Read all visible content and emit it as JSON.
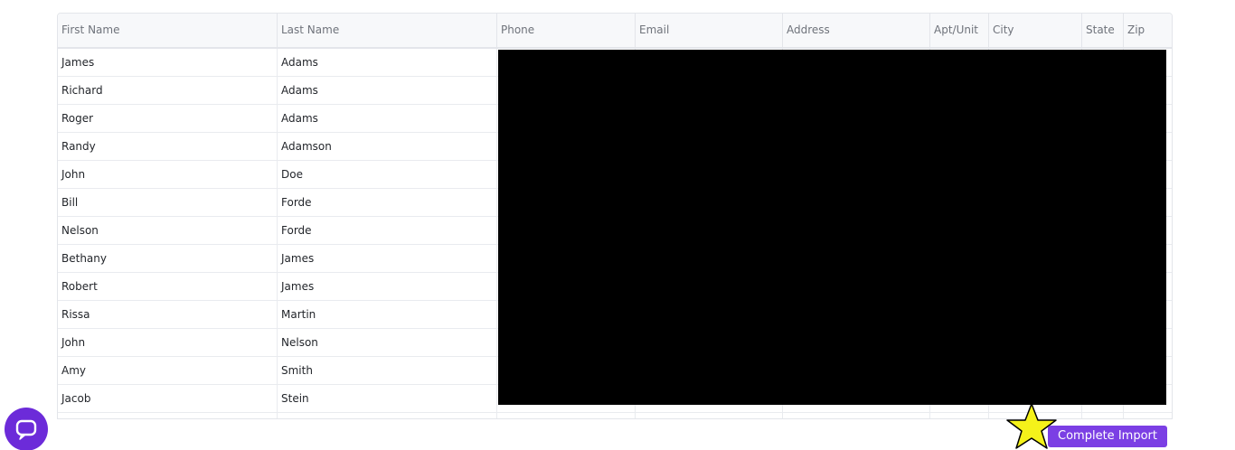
{
  "table": {
    "headers": [
      "First Name",
      "Last Name",
      "Phone",
      "Email",
      "Address",
      "Apt/Unit",
      "City",
      "State",
      "Zip"
    ],
    "rows": [
      {
        "first": "James",
        "last": "Adams"
      },
      {
        "first": "Richard",
        "last": "Adams"
      },
      {
        "first": "Roger",
        "last": "Adams"
      },
      {
        "first": "Randy",
        "last": "Adamson"
      },
      {
        "first": "John",
        "last": "Doe"
      },
      {
        "first": "Bill",
        "last": "Forde"
      },
      {
        "first": "Nelson",
        "last": "Forde"
      },
      {
        "first": "Bethany",
        "last": "James"
      },
      {
        "first": "Robert",
        "last": "James"
      },
      {
        "first": "Rissa",
        "last": "Martin"
      },
      {
        "first": "John",
        "last": "Nelson"
      },
      {
        "first": "Amy",
        "last": "Smith"
      },
      {
        "first": "Jacob",
        "last": "Stein"
      },
      {
        "first": "",
        "last": ""
      }
    ]
  },
  "actions": {
    "complete_import_label": "Complete Import"
  },
  "icons": {
    "chat": "chat-bubble-icon",
    "star": "star-icon"
  },
  "colors": {
    "accent": "#7b3fe4",
    "chat": "#6c2bd9",
    "star": "#f5f21a",
    "redaction": "#000000"
  }
}
